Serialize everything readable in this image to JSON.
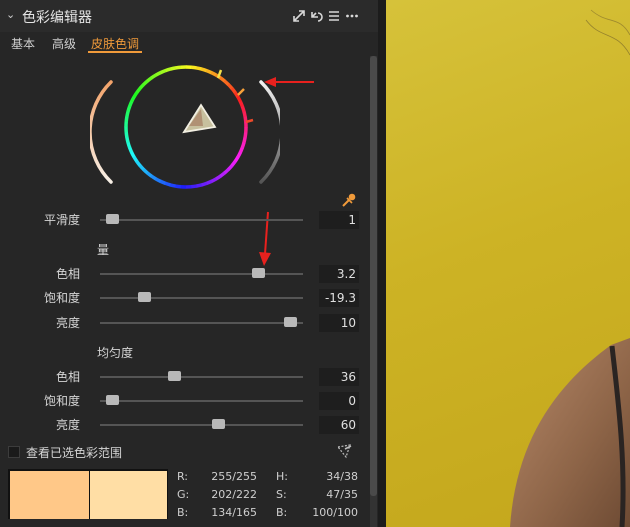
{
  "header": {
    "title": "色彩编辑器"
  },
  "tabs": [
    {
      "label": "基本",
      "active": false
    },
    {
      "label": "高级",
      "active": false
    },
    {
      "label": "皮肤色调",
      "active": true
    }
  ],
  "smoothing": {
    "label": "平滑度",
    "value": "1",
    "fraction": 0.03
  },
  "amount": {
    "title": "量",
    "rows": [
      {
        "label": "色相",
        "value": "3.2",
        "fraction": 0.8
      },
      {
        "label": "饱和度",
        "value": "-19.3",
        "fraction": 0.2
      },
      {
        "label": "亮度",
        "value": "10",
        "fraction": 0.97
      }
    ]
  },
  "uniformity": {
    "title": "均匀度",
    "rows": [
      {
        "label": "色相",
        "value": "36",
        "fraction": 0.36
      },
      {
        "label": "饱和度",
        "value": "0",
        "fraction": 0.03
      },
      {
        "label": "亮度",
        "value": "60",
        "fraction": 0.59
      }
    ]
  },
  "view_selected": {
    "label": "查看已选色彩范围",
    "checked": false
  },
  "swatches": {
    "left": "#ffc888",
    "right": "#ffdea5"
  },
  "readout": {
    "r_label": "R:",
    "r": "255/255",
    "g_label": "G:",
    "g": "202/222",
    "b_label": "B:",
    "b": "134/165",
    "h_label": "H:",
    "h": "34/38",
    "s_label": "S:",
    "s": "47/35",
    "bb_label": "B:",
    "bb": "100/100"
  },
  "colors": {
    "accent": "#f09a3a",
    "panel_bg": "#262626",
    "arrow": "#e8211e"
  },
  "icons": [
    "chevron-down-icon",
    "expand-icon",
    "reset-icon",
    "menu-icon",
    "more-icon",
    "eyedropper-icon",
    "color-picker-icon"
  ]
}
